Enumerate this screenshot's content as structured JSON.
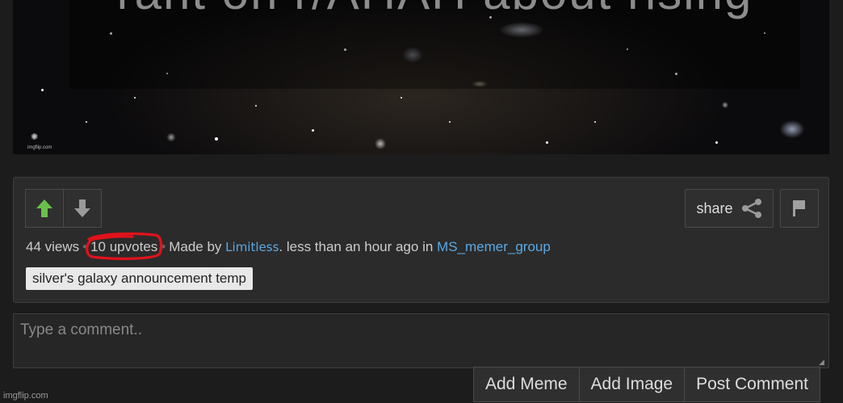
{
  "image": {
    "caption": "rant on r/AHAH about rising"
  },
  "watermark": {
    "small": "imgflip.com"
  },
  "post": {
    "share_label": "share",
    "views": "44 views",
    "upvotes": "10 upvotes",
    "made_by_label": "Made by",
    "author": "Limitless",
    "time_text": ". less than an hour ago in",
    "stream": "MS_memer_group",
    "tag": "silver's galaxy announcement temp"
  },
  "comment": {
    "placeholder": "Type a comment..",
    "buttons": {
      "add_meme": "Add Meme",
      "add_image": "Add Image",
      "post_comment": "Post Comment"
    }
  },
  "footer": {
    "brand": "imgflip.com"
  },
  "colors": {
    "upvote_green": "#6bc04b",
    "link_blue": "#5aa9e6",
    "annotation_red": "#e0121b"
  }
}
